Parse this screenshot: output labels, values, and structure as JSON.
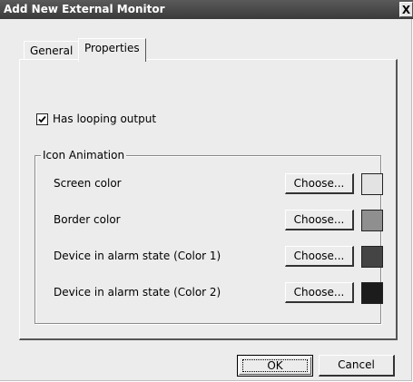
{
  "window": {
    "title": "Add New External Monitor",
    "close_label": "X"
  },
  "tabs": [
    {
      "label": "General",
      "active": false
    },
    {
      "label": "Properties",
      "active": true
    }
  ],
  "properties": {
    "looping_checkbox": {
      "label": "Has looping output",
      "checked": true
    },
    "icon_animation": {
      "legend": "Icon Animation",
      "rows": [
        {
          "label": "Screen color",
          "button_label": "Choose...",
          "color": "#e3e3e3"
        },
        {
          "label": "Border color",
          "button_label": "Choose...",
          "color": "#8f8f8f"
        },
        {
          "label": "Device in alarm state (Color 1)",
          "button_label": "Choose...",
          "color": "#444444"
        },
        {
          "label": "Device in alarm state (Color 2)",
          "button_label": "Choose...",
          "color": "#1c1c1c"
        }
      ]
    }
  },
  "footer": {
    "ok_label": "OK",
    "cancel_label": "Cancel"
  }
}
